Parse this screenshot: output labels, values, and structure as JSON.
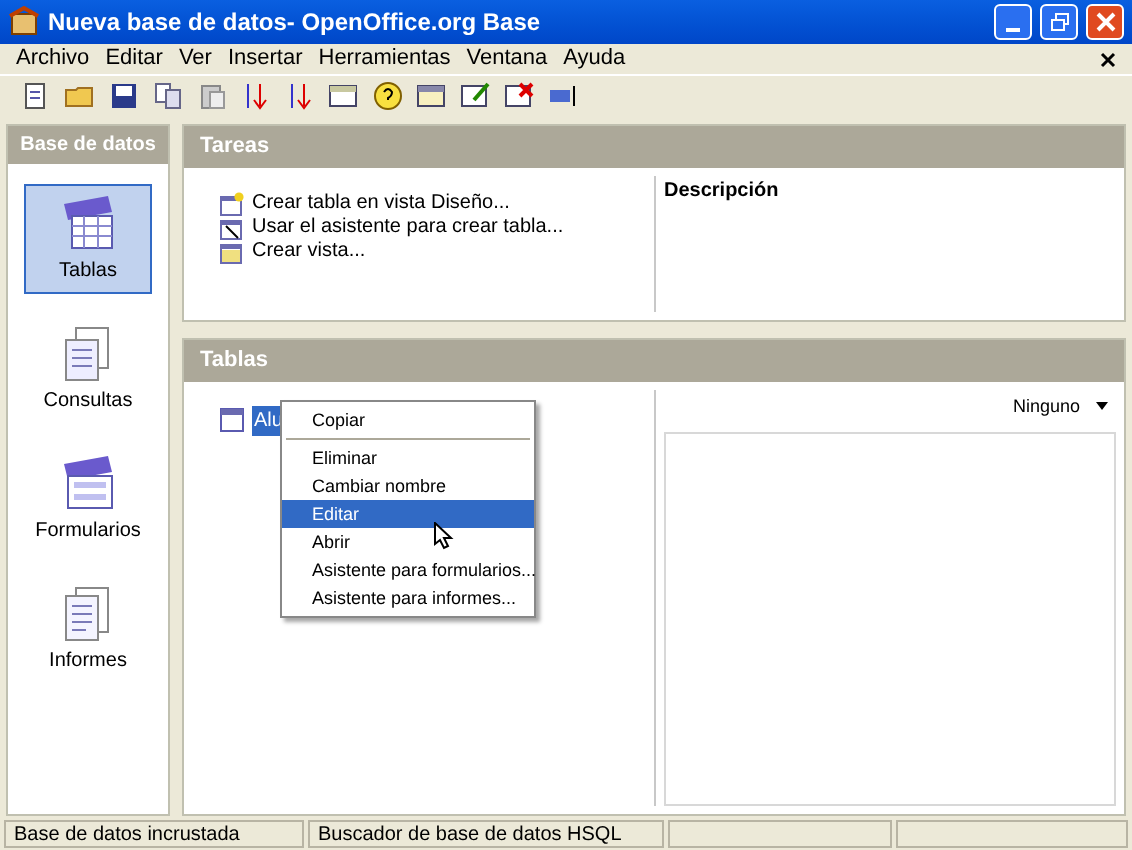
{
  "window": {
    "title": "Nueva base de datos- OpenOffice.org Base"
  },
  "menu": [
    "Archivo",
    "Editar",
    "Ver",
    "Insertar",
    "Herramientas",
    "Ventana",
    "Ayuda"
  ],
  "sidebar": {
    "title": "Base de datos",
    "items": [
      {
        "label": "Tablas",
        "selected": true,
        "kind": "table"
      },
      {
        "label": "Consultas",
        "selected": false,
        "kind": "query"
      },
      {
        "label": "Formularios",
        "selected": false,
        "kind": "form"
      },
      {
        "label": "Informes",
        "selected": false,
        "kind": "report"
      }
    ]
  },
  "tasks": {
    "title": "Tareas",
    "items": [
      "Crear tabla en vista Diseño...",
      "Usar el asistente para crear tabla...",
      "Crear vista..."
    ],
    "description_title": "Descripción"
  },
  "tables": {
    "title": "Tablas",
    "items": [
      {
        "label": "Alu",
        "selected": true
      }
    ],
    "preview_mode": "Ninguno"
  },
  "context_menu": [
    {
      "kind": "item",
      "label": "Copiar",
      "selected": false
    },
    {
      "kind": "separator"
    },
    {
      "kind": "item",
      "label": "Eliminar",
      "selected": false
    },
    {
      "kind": "item",
      "label": "Cambiar nombre",
      "selected": false
    },
    {
      "kind": "item",
      "label": "Editar",
      "selected": true
    },
    {
      "kind": "item",
      "label": "Abrir",
      "selected": false
    },
    {
      "kind": "item",
      "label": "Asistente para formularios...",
      "selected": false
    },
    {
      "kind": "item",
      "label": "Asistente para informes...",
      "selected": false
    }
  ],
  "status_bar": [
    "Base de datos incrustada",
    "Buscador de base de datos HSQL"
  ]
}
